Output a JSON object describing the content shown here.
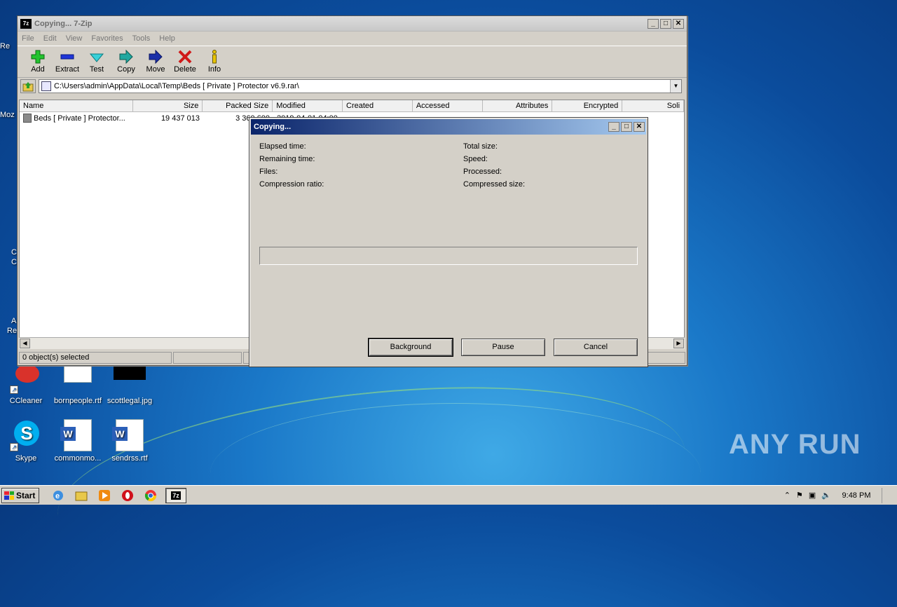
{
  "desktop": {
    "icons": [
      {
        "label": "CCleaner"
      },
      {
        "label": "bornpeople.rtf"
      },
      {
        "label": "scottlegal.jpg"
      },
      {
        "label": "Skype"
      },
      {
        "label": "commonmo..."
      },
      {
        "label": "sendrss.rtf"
      }
    ],
    "edge_fragments": [
      "Re",
      "Moz",
      "C",
      "C",
      "A",
      "Re"
    ],
    "watermark": "ANY RUN"
  },
  "window": {
    "title": "Copying... 7-Zip",
    "menu": [
      "File",
      "Edit",
      "View",
      "Favorites",
      "Tools",
      "Help"
    ],
    "toolbar": [
      {
        "label": "Add",
        "icon": "plus-icon"
      },
      {
        "label": "Extract",
        "icon": "minus-icon"
      },
      {
        "label": "Test",
        "icon": "check-icon"
      },
      {
        "label": "Copy",
        "icon": "double-arrow-icon"
      },
      {
        "label": "Move",
        "icon": "arrow-right-icon"
      },
      {
        "label": "Delete",
        "icon": "x-icon"
      },
      {
        "label": "Info",
        "icon": "info-icon"
      }
    ],
    "address": "C:\\Users\\admin\\AppData\\Local\\Temp\\Beds [ Private ] Protector v6.9.rar\\",
    "columns": [
      "Name",
      "Size",
      "Packed Size",
      "Modified",
      "Created",
      "Accessed",
      "Attributes",
      "Encrypted",
      "Soli"
    ],
    "rows": [
      {
        "name": "Beds [ Private ] Protector...",
        "size": "19 437 013",
        "packed": "3 360 600",
        "modified": "2019-04-01 04:00"
      }
    ],
    "status": "0 object(s) selected"
  },
  "dialog": {
    "title": "Copying...",
    "stats_left": [
      "Elapsed time:",
      "Remaining time:",
      "Files:",
      "Compression ratio:"
    ],
    "stats_right": [
      "Total size:",
      "Speed:",
      "Processed:",
      "Compressed size:"
    ],
    "progress": 0,
    "buttons": {
      "background": "Background",
      "pause": "Pause",
      "cancel": "Cancel"
    }
  },
  "taskbar": {
    "start_label": "Start",
    "clock": "9:48 PM",
    "active_task": "7z"
  },
  "colors": {
    "dialog_title": "#0a246a",
    "window_chrome": "#d4d0c8",
    "desktop": "#1a78c8"
  }
}
